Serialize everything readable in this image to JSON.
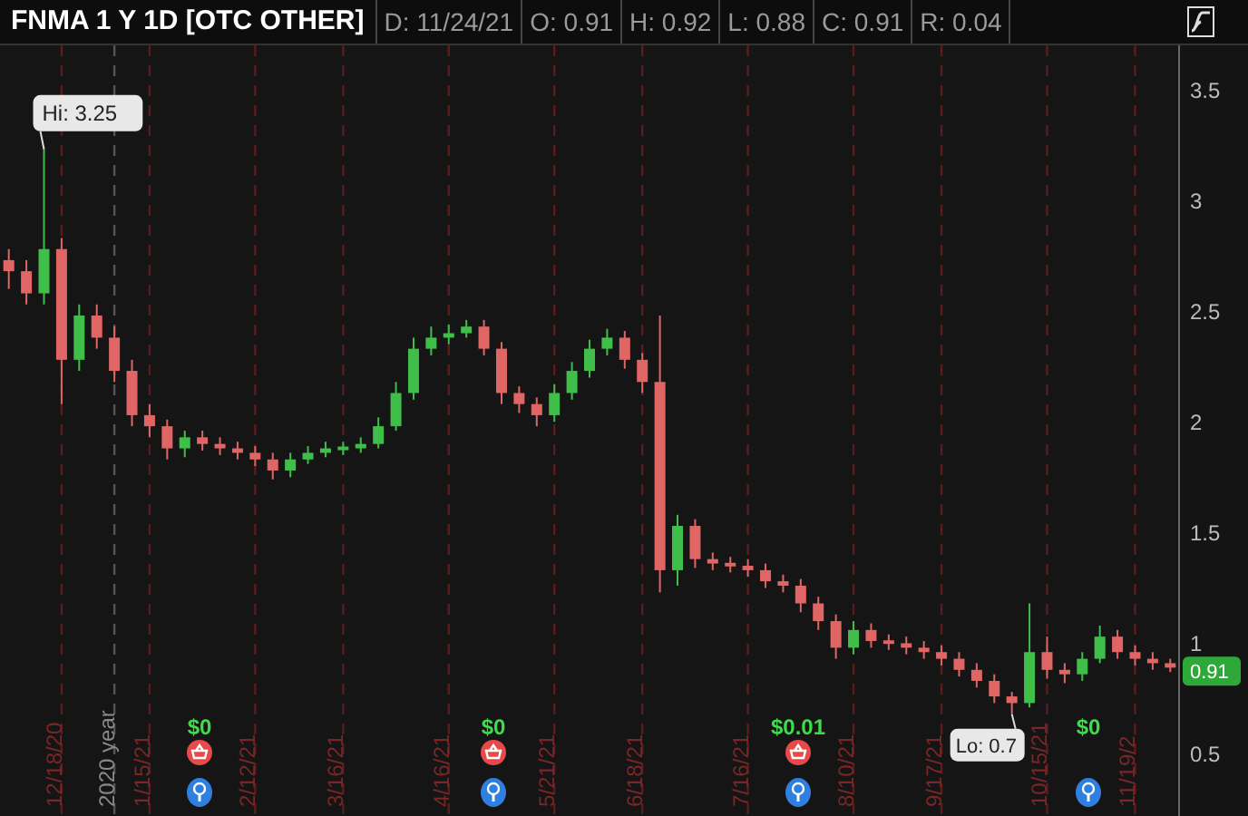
{
  "header": {
    "title": "FNMA 1 Y 1D [OTC OTHER]",
    "fields": [
      "D: 11/24/21",
      "O: 0.91",
      "H: 0.92",
      "L: 0.88",
      "C: 0.91",
      "R: 0.04"
    ]
  },
  "chart": {
    "chart_data": {
      "type": "candlestick",
      "grid": true,
      "ylim": [
        0.24,
        3.72
      ],
      "yticks": [
        0.5,
        1,
        1.5,
        2,
        2.5,
        3,
        3.5
      ],
      "categories": [
        null,
        null,
        null,
        "12/18/20",
        null,
        null,
        "2020 year",
        null,
        "1/15/21",
        null,
        null,
        null,
        null,
        null,
        "2/12/21",
        null,
        null,
        null,
        null,
        "3/16/21",
        null,
        null,
        null,
        null,
        null,
        "4/16/21",
        null,
        null,
        null,
        null,
        null,
        "5/21/21",
        null,
        null,
        null,
        null,
        "6/18/21",
        null,
        null,
        null,
        null,
        null,
        "7/16/21",
        null,
        null,
        null,
        null,
        null,
        "8/10/21",
        null,
        null,
        null,
        null,
        "9/17/21",
        null,
        null,
        null,
        null,
        null,
        "10/15/21",
        null,
        null,
        null,
        null,
        "11/19/2",
        null,
        null
      ],
      "ohlc": [
        [
          2.75,
          2.8,
          2.62,
          2.7
        ],
        [
          2.7,
          2.75,
          2.55,
          2.6
        ],
        [
          2.6,
          3.25,
          2.55,
          2.8
        ],
        [
          2.8,
          2.85,
          2.1,
          2.3
        ],
        [
          2.3,
          2.55,
          2.25,
          2.5
        ],
        [
          2.5,
          2.55,
          2.35,
          2.4
        ],
        [
          2.4,
          2.45,
          2.2,
          2.25
        ],
        [
          2.25,
          2.3,
          2.0,
          2.05
        ],
        [
          2.05,
          2.1,
          1.95,
          2.0
        ],
        [
          2.0,
          2.03,
          1.85,
          1.9
        ],
        [
          1.9,
          1.98,
          1.86,
          1.95
        ],
        [
          1.95,
          1.98,
          1.89,
          1.92
        ],
        [
          1.92,
          1.95,
          1.87,
          1.9
        ],
        [
          1.9,
          1.93,
          1.85,
          1.88
        ],
        [
          1.88,
          1.91,
          1.82,
          1.85
        ],
        [
          1.85,
          1.88,
          1.76,
          1.8
        ],
        [
          1.8,
          1.88,
          1.77,
          1.85
        ],
        [
          1.85,
          1.91,
          1.83,
          1.88
        ],
        [
          1.88,
          1.93,
          1.86,
          1.9
        ],
        [
          1.9,
          1.93,
          1.87,
          1.9
        ],
        [
          1.9,
          1.95,
          1.88,
          1.92
        ],
        [
          1.92,
          2.04,
          1.9,
          2.0
        ],
        [
          2.0,
          2.2,
          1.98,
          2.15
        ],
        [
          2.15,
          2.4,
          2.12,
          2.35
        ],
        [
          2.35,
          2.45,
          2.32,
          2.4
        ],
        [
          2.4,
          2.46,
          2.37,
          2.42
        ],
        [
          2.42,
          2.48,
          2.4,
          2.45
        ],
        [
          2.45,
          2.48,
          2.32,
          2.35
        ],
        [
          2.35,
          2.38,
          2.1,
          2.15
        ],
        [
          2.15,
          2.18,
          2.06,
          2.1
        ],
        [
          2.1,
          2.13,
          2.0,
          2.05
        ],
        [
          2.05,
          2.19,
          2.02,
          2.15
        ],
        [
          2.15,
          2.29,
          2.12,
          2.25
        ],
        [
          2.25,
          2.39,
          2.22,
          2.35
        ],
        [
          2.35,
          2.44,
          2.32,
          2.4
        ],
        [
          2.4,
          2.43,
          2.26,
          2.3
        ],
        [
          2.3,
          2.33,
          2.15,
          2.2
        ],
        [
          2.2,
          2.5,
          1.25,
          1.35
        ],
        [
          1.35,
          1.6,
          1.28,
          1.55
        ],
        [
          1.55,
          1.58,
          1.36,
          1.4
        ],
        [
          1.4,
          1.43,
          1.35,
          1.38
        ],
        [
          1.38,
          1.41,
          1.34,
          1.37
        ],
        [
          1.37,
          1.4,
          1.32,
          1.35
        ],
        [
          1.35,
          1.38,
          1.27,
          1.3
        ],
        [
          1.3,
          1.33,
          1.25,
          1.28
        ],
        [
          1.28,
          1.31,
          1.16,
          1.2
        ],
        [
          1.2,
          1.23,
          1.08,
          1.12
        ],
        [
          1.12,
          1.15,
          0.95,
          1.0
        ],
        [
          1.0,
          1.12,
          0.97,
          1.08
        ],
        [
          1.08,
          1.11,
          1.0,
          1.03
        ],
        [
          1.03,
          1.06,
          0.99,
          1.02
        ],
        [
          1.02,
          1.05,
          0.97,
          1.0
        ],
        [
          1.0,
          1.03,
          0.95,
          0.98
        ],
        [
          0.98,
          1.01,
          0.92,
          0.95
        ],
        [
          0.95,
          0.98,
          0.87,
          0.9
        ],
        [
          0.9,
          0.93,
          0.82,
          0.85
        ],
        [
          0.85,
          0.88,
          0.75,
          0.78
        ],
        [
          0.78,
          0.8,
          0.7,
          0.75
        ],
        [
          0.75,
          1.2,
          0.73,
          0.98
        ],
        [
          0.98,
          1.05,
          0.86,
          0.9
        ],
        [
          0.9,
          0.93,
          0.84,
          0.88
        ],
        [
          0.88,
          0.98,
          0.85,
          0.95
        ],
        [
          0.95,
          1.1,
          0.93,
          1.05
        ],
        [
          1.05,
          1.08,
          0.95,
          0.98
        ],
        [
          0.98,
          1.01,
          0.92,
          0.95
        ],
        [
          0.95,
          0.98,
          0.9,
          0.93
        ],
        [
          0.93,
          0.95,
          0.89,
          0.91
        ]
      ],
      "annotations": [
        "Hi: 3.25",
        "Lo: 0.7",
        "0.91"
      ]
    },
    "events": [
      {
        "amount": "$0",
        "dividend": true
      },
      {
        "amount": "$0",
        "dividend": true
      },
      {
        "amount": "$0.01",
        "dividend": true
      },
      {
        "amount": "$0",
        "dividend": false
      }
    ]
  }
}
